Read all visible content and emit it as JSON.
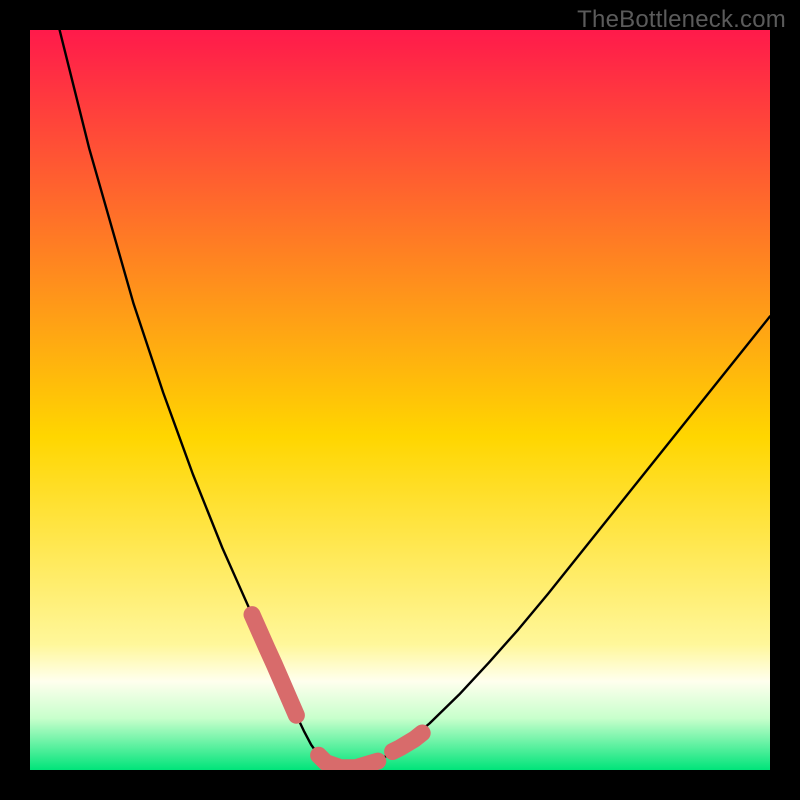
{
  "attribution": "TheBottleneck.com",
  "gradient": {
    "top": "#ff1a4b",
    "mid55": "#ffd600",
    "mid83": "#fff79a",
    "mid88": "#ffffee",
    "mid93": "#c8ffcc",
    "bottom": "#00e47a"
  },
  "curve_color": "#000000",
  "highlight_color": "#d86b6b",
  "chart_data": {
    "type": "line",
    "title": "",
    "xlabel": "",
    "ylabel": "",
    "xlim": [
      0,
      100
    ],
    "ylim": [
      0,
      100
    ],
    "grid": false,
    "legend": false,
    "series": [
      {
        "name": "curve",
        "x": [
          4,
          6,
          8,
          10,
          12,
          14,
          16,
          18,
          20,
          22,
          24,
          26,
          28,
          30,
          32,
          33,
          34,
          35,
          36,
          37,
          38,
          39,
          40,
          42,
          44,
          47,
          50,
          54,
          58,
          62,
          66,
          70,
          74,
          78,
          82,
          86,
          90,
          94,
          98,
          100
        ],
        "y": [
          100,
          92,
          84,
          77,
          70,
          63,
          57,
          51,
          45.5,
          40,
          35,
          30,
          25.5,
          21,
          16.5,
          14.3,
          12,
          9.7,
          7.4,
          5.3,
          3.4,
          2,
          1,
          0.3,
          0.3,
          1.2,
          3,
          6.3,
          10.2,
          14.5,
          19,
          23.8,
          28.8,
          33.8,
          38.8,
          43.8,
          48.8,
          53.8,
          58.8,
          61.3
        ]
      }
    ],
    "highlight_segments": [
      {
        "x": [
          30,
          32,
          33,
          34,
          35,
          36
        ],
        "y": [
          21,
          16.5,
          14.3,
          12,
          9.7,
          7.4
        ]
      },
      {
        "x": [
          39,
          40,
          42,
          44,
          47
        ],
        "y": [
          2,
          1,
          0.3,
          0.3,
          1.2
        ]
      },
      {
        "x": [
          49,
          50,
          52,
          53
        ],
        "y": [
          2.5,
          3,
          4.2,
          5
        ]
      }
    ]
  }
}
